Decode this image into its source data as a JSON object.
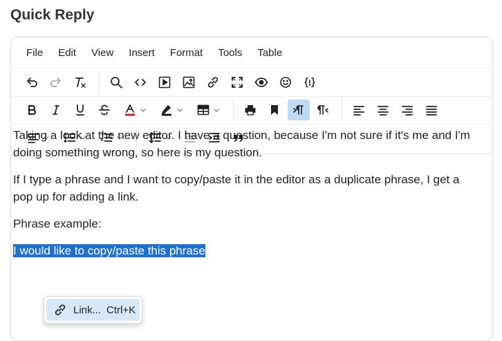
{
  "page": {
    "title": "Quick Reply"
  },
  "menubar": {
    "items": [
      "File",
      "Edit",
      "View",
      "Insert",
      "Format",
      "Tools",
      "Table"
    ]
  },
  "toolbar": {
    "row1": [
      "undo-icon",
      "redo-icon",
      "clear-formatting-icon",
      "search-icon",
      "source-code-icon",
      "media-icon",
      "image-icon",
      "link-icon",
      "fullscreen-icon",
      "preview-icon",
      "emoticons-icon",
      "template-icon"
    ],
    "row2": [
      "bold-icon",
      "italic-icon",
      "underline-icon",
      "strikethrough-icon",
      "text-color-icon",
      "highlight-color-icon",
      "table-icon",
      "print-icon",
      "anchor-icon",
      "ltr-icon",
      "rtl-icon",
      "align-left-icon",
      "align-center-icon",
      "align-right-icon",
      "justify-icon"
    ],
    "row3": [
      "align-dropdown-icon",
      "bullet-list-icon",
      "numbered-list-icon",
      "line-height-icon",
      "outdent-icon",
      "indent-icon",
      "blockquote-icon"
    ],
    "active": "ltr-icon"
  },
  "content": {
    "paragraphs": [
      "Taking a look at the new editor.  I have a question, because I'm not sure if it's me and I'm doing something wrong, so here is my question.",
      "If I type a phrase and I want to copy/paste it in the editor as a duplicate phrase, I get a pop up for adding a link.",
      "Phrase example:"
    ],
    "selected_text": "I would like to copy/paste this phrase"
  },
  "context_menu": {
    "item_label": "Link...",
    "shortcut": "Ctrl+K"
  },
  "colors": {
    "selection": "#1f6fd1",
    "active_button": "#bcd9f5",
    "context_highlight": "#d7e8f8"
  }
}
